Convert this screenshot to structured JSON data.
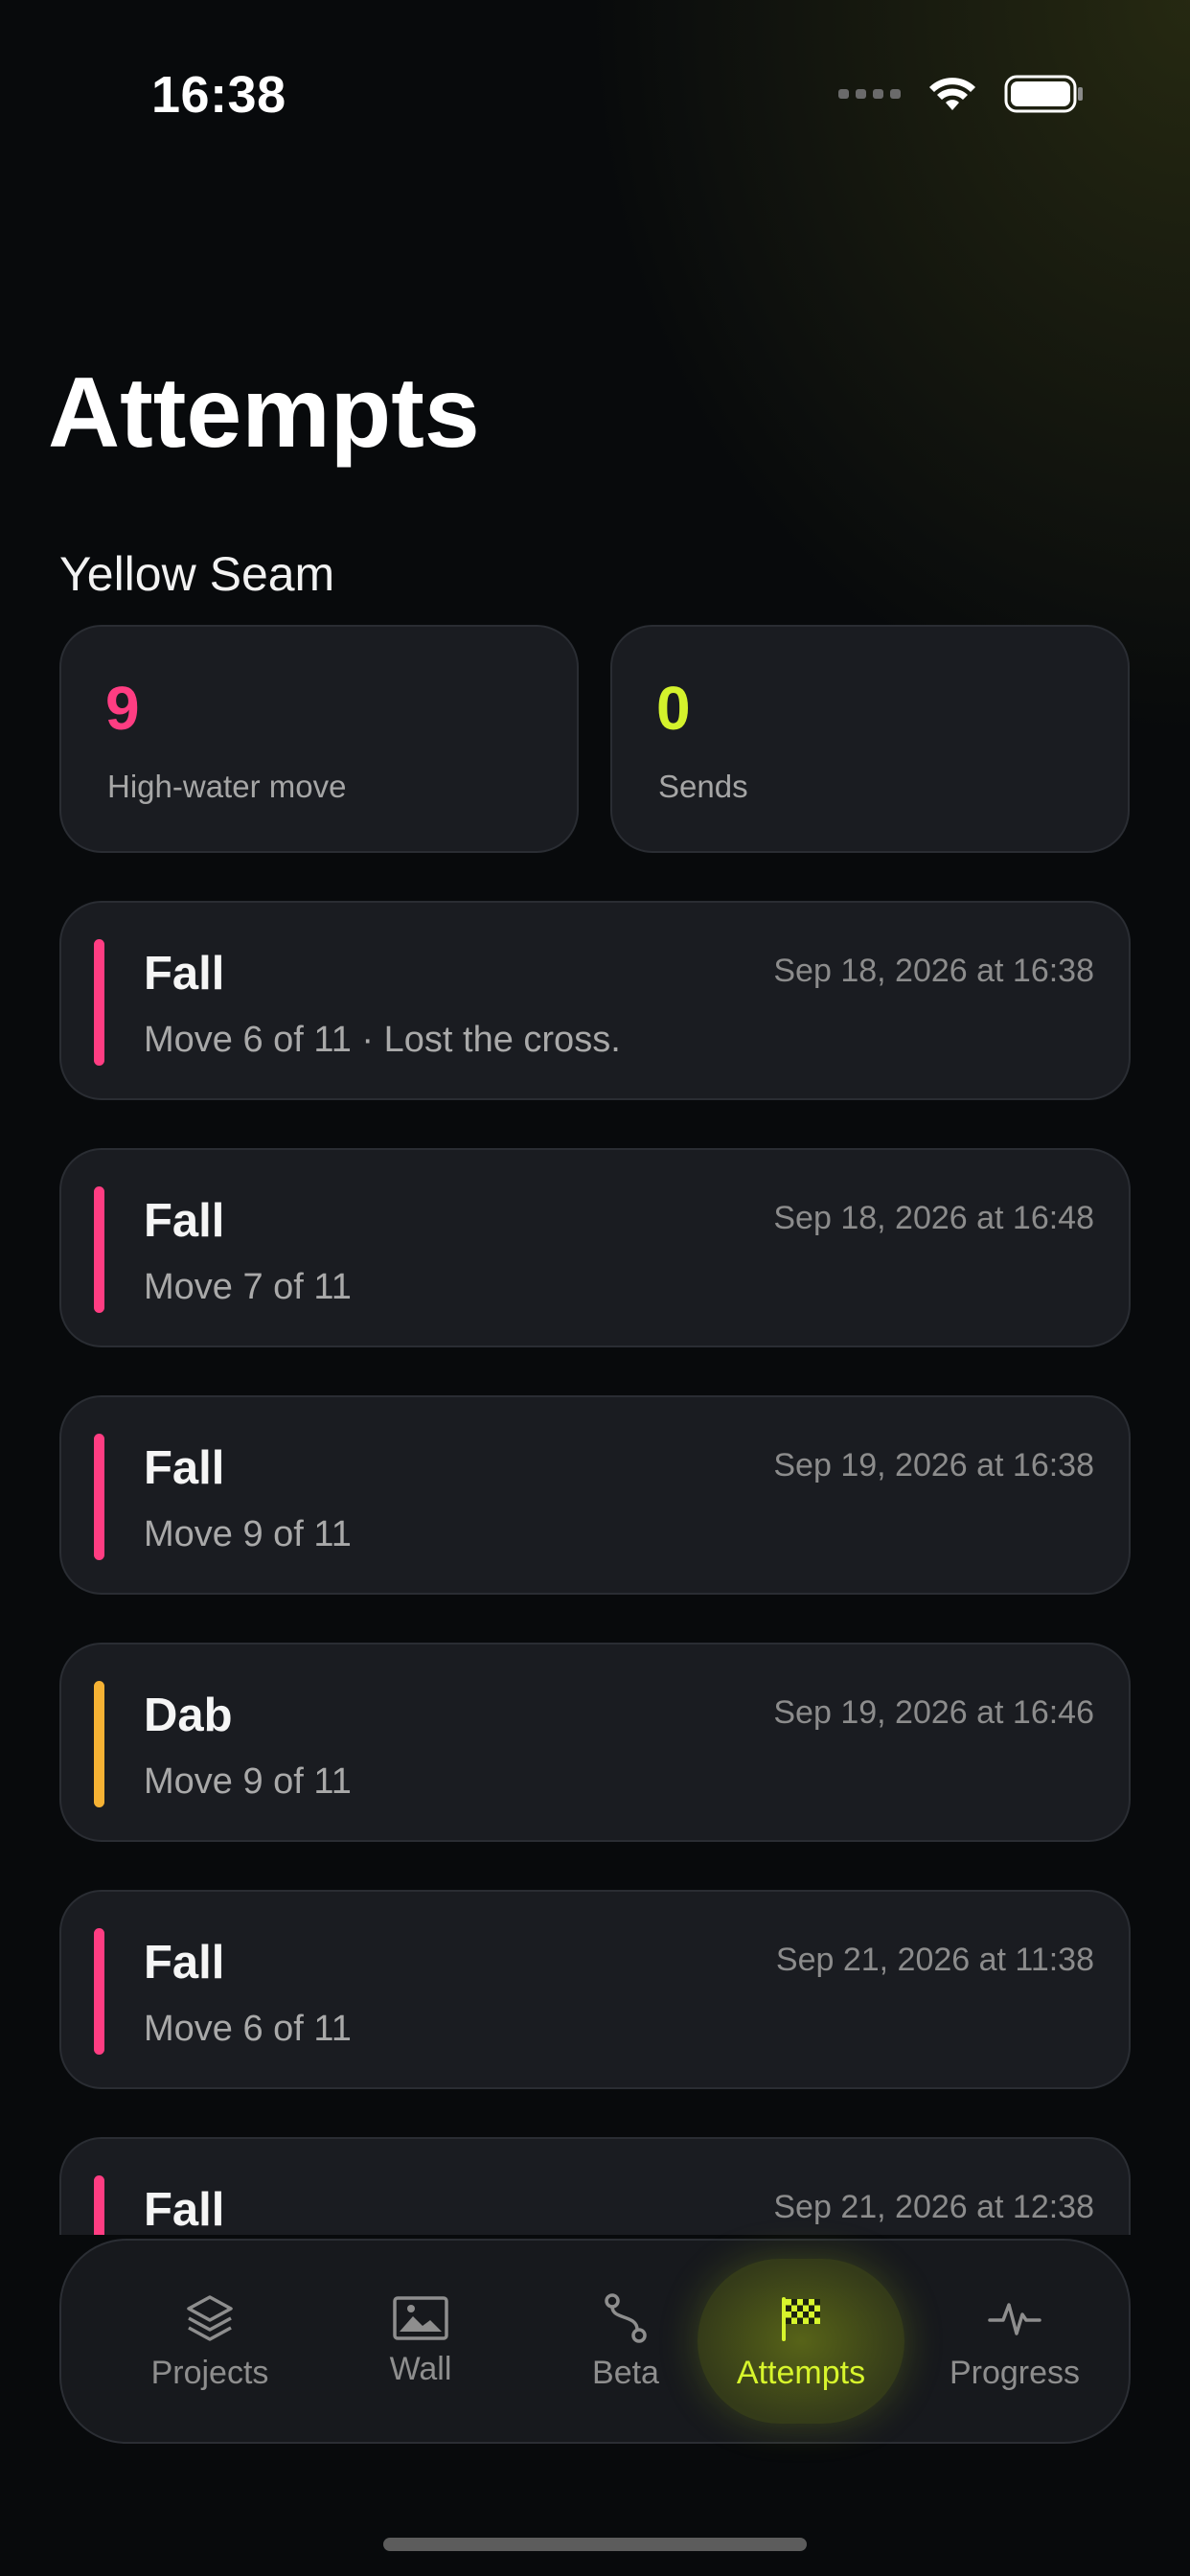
{
  "status_bar": {
    "time": "16:38"
  },
  "header": {
    "title": "Attempts"
  },
  "project": {
    "name": "Yellow Seam"
  },
  "stats": [
    {
      "value": "9",
      "label": "High-water move",
      "color": "#ff3d82"
    },
    {
      "value": "0",
      "label": "Sends",
      "color": "#d4f22c"
    }
  ],
  "colors": {
    "fall": "#ff3d82",
    "dab": "#f6b234",
    "accent": "#d7f52c"
  },
  "attempts": [
    {
      "type": "Fall",
      "detail": "Move 6 of 11 · Lost the cross.",
      "date": "Sep 18, 2026 at 16:38",
      "color": "#ff3d82"
    },
    {
      "type": "Fall",
      "detail": "Move 7 of 11",
      "date": "Sep 18, 2026 at 16:48",
      "color": "#ff3d82"
    },
    {
      "type": "Fall",
      "detail": "Move 9 of 11",
      "date": "Sep 19, 2026 at 16:38",
      "color": "#ff3d82"
    },
    {
      "type": "Dab",
      "detail": "Move 9 of 11",
      "date": "Sep 19, 2026 at 16:46",
      "color": "#f6b234"
    },
    {
      "type": "Fall",
      "detail": "Move 6 of 11",
      "date": "Sep 21, 2026 at 11:38",
      "color": "#ff3d82"
    },
    {
      "type": "Fall",
      "detail": "",
      "date": "Sep 21, 2026 at 12:38",
      "color": "#ff3d82"
    }
  ],
  "tabs": [
    {
      "label": "Projects",
      "icon": "layers-icon",
      "active": false
    },
    {
      "label": "Wall",
      "icon": "image-icon",
      "active": false
    },
    {
      "label": "Beta",
      "icon": "route-icon",
      "active": false
    },
    {
      "label": "Attempts",
      "icon": "checkered-flag-icon",
      "active": true
    },
    {
      "label": "Progress",
      "icon": "pulse-icon",
      "active": false
    }
  ]
}
